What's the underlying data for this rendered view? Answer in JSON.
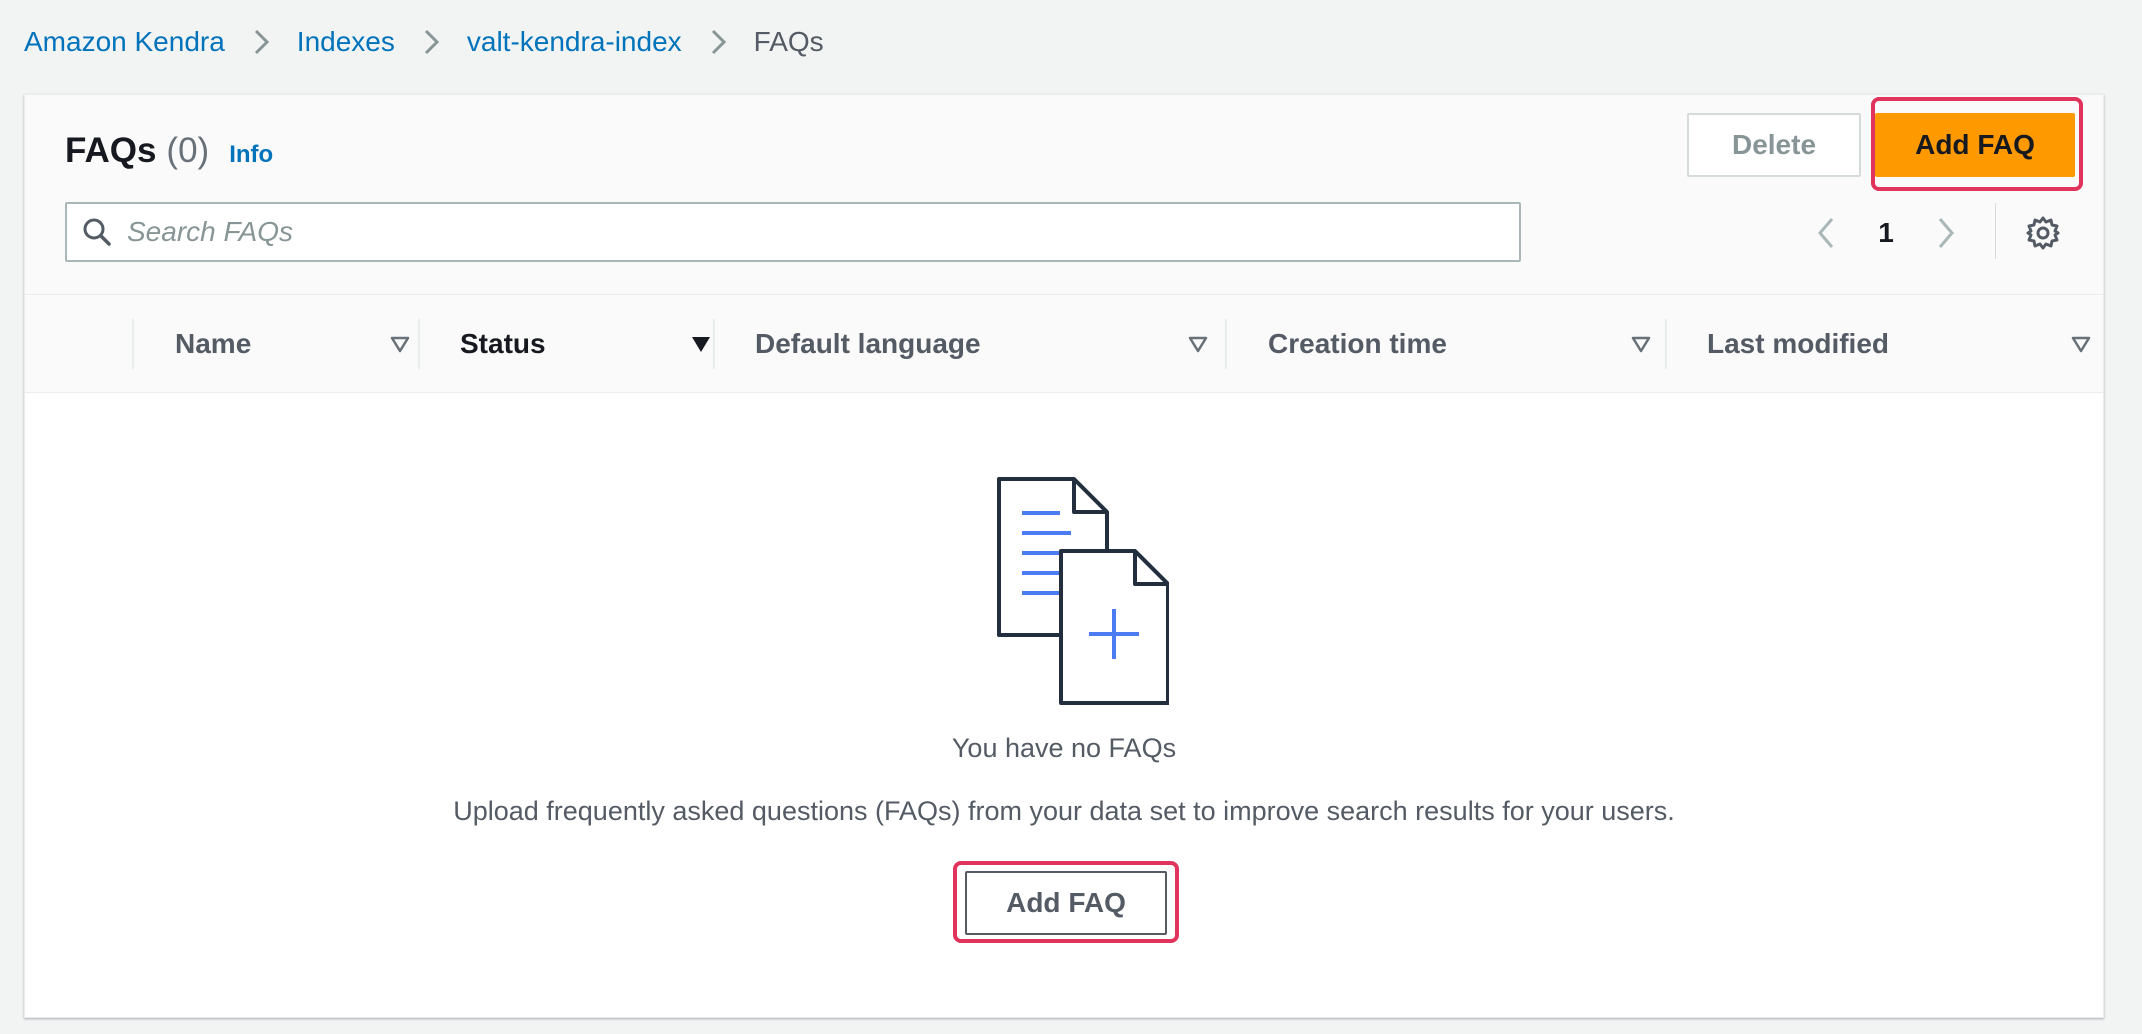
{
  "breadcrumb": {
    "items": [
      {
        "label": "Amazon Kendra"
      },
      {
        "label": "Indexes"
      },
      {
        "label": "valt-kendra-index"
      },
      {
        "label": "FAQs"
      }
    ]
  },
  "header": {
    "title": "FAQs",
    "count": "(0)",
    "info": "Info",
    "delete_label": "Delete",
    "add_label": "Add FAQ"
  },
  "search": {
    "placeholder": "Search FAQs",
    "value": ""
  },
  "pagination": {
    "current_page": "1"
  },
  "table": {
    "columns": [
      {
        "label": "Name"
      },
      {
        "label": "Status"
      },
      {
        "label": "Default language"
      },
      {
        "label": "Creation time"
      },
      {
        "label": "Last modified"
      }
    ],
    "sorted_column": "Status"
  },
  "empty_state": {
    "title": "You have no FAQs",
    "description": "Upload frequently asked questions (FAQs) from your data set to improve search results for your users.",
    "button_label": "Add FAQ"
  },
  "colors": {
    "link": "#0073bb",
    "primary_button": "#ff9900",
    "highlight": "#e0345c",
    "illustration_accent": "#4c7cf3"
  },
  "icons": [
    "search-icon",
    "chevron-left-icon",
    "chevron-right-icon",
    "gear-icon",
    "sort-down-icon",
    "sort-down-filled-icon",
    "document-add-illustration"
  ]
}
